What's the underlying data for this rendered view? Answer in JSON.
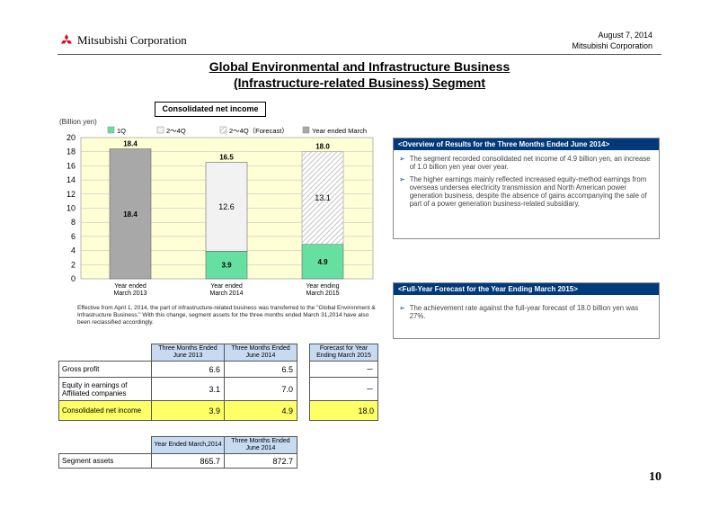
{
  "header": {
    "company": "Mitsubishi Corporation",
    "date": "August 7, 2014",
    "company_right": "Mitsubishi Corporation"
  },
  "title_line1": "Global Environmental and Infrastructure Business",
  "title_line2": "(Infrastructure-related Business) Segment",
  "chart_box_label": "Consolidated net income",
  "chart_data": {
    "type": "bar",
    "title": "Consolidated net income",
    "ylabel": "(Billion yen)",
    "ylim": [
      0,
      20
    ],
    "yticks": [
      0,
      2,
      4,
      6,
      8,
      10,
      12,
      14,
      16,
      18,
      20
    ],
    "grid": true,
    "legend": [
      "1Q",
      "2～4Q",
      "2～4Q（Forecast）",
      "Year ended March"
    ],
    "categories": [
      "Year ended\nMarch 2013",
      "Year ended\nMarch 2014",
      "Year ending\nMarch 2015"
    ],
    "series": [
      {
        "name": "1Q",
        "values": [
          null,
          3.9,
          4.9
        ]
      },
      {
        "name": "2～4Q",
        "values": [
          null,
          12.6,
          null
        ]
      },
      {
        "name": "2～4Q（Forecast）",
        "values": [
          null,
          null,
          13.1
        ]
      },
      {
        "name": "Year ended March",
        "values": [
          18.4,
          null,
          null
        ]
      }
    ],
    "totals": [
      18.4,
      16.5,
      18.0
    ],
    "colors": {
      "q1": "#66e0a0",
      "q2_4": "#f2f2f2",
      "forecast_hatch": "#b0b0b0",
      "year": "#a8a8a8",
      "plot_bg": "#ffffd6"
    }
  },
  "chart_note": "Effective from April 1, 2014, the part of infrastructure-related business was transferred to the \"Global Environment & Infrastructure Business.\" With this change, segment assets for the three months ended March 31,2014 have also been reclassified accordingly.",
  "overview": {
    "heading": "<Overview of Results for the Three Months Ended June 2014>",
    "bullets": [
      "The segment recorded consolidated net income of 4.9 billion yen, an increase of 1.0 billion yen year over year.",
      "The higher earnings mainly reflected increased equity-method earnings from overseas undersea electricity transmission and North American power generation business, despite the absence of gains accompanying the sale of part of a power generation business-related subsidiary."
    ]
  },
  "forecast": {
    "heading": "<Full-Year Forecast for the Year Ending March 2015>",
    "bullets": [
      "The achievement rate against the full-year forecast of 18.0 billion yen was 27%."
    ]
  },
  "table1": {
    "headers": [
      "Three Months Ended June 2013",
      "Three Months Ended June 2014",
      "Forecast for Year Ending March 2015"
    ],
    "rows": [
      {
        "label": "Gross profit",
        "v1": "6.6",
        "v2": "6.5",
        "f": "－"
      },
      {
        "label": "Equity in earnings of Affiliated companies",
        "v1": "3.1",
        "v2": "7.0",
        "f": "－"
      },
      {
        "label": "Consolidated net income",
        "v1": "3.9",
        "v2": "4.9",
        "f": "18.0"
      }
    ]
  },
  "table2": {
    "headers": [
      "Year Ended March,2014",
      "Three Months Ended June 2014"
    ],
    "rows": [
      {
        "label": "Segment assets",
        "v1": "865.7",
        "v2": "872.7"
      }
    ]
  },
  "page_number": "10"
}
